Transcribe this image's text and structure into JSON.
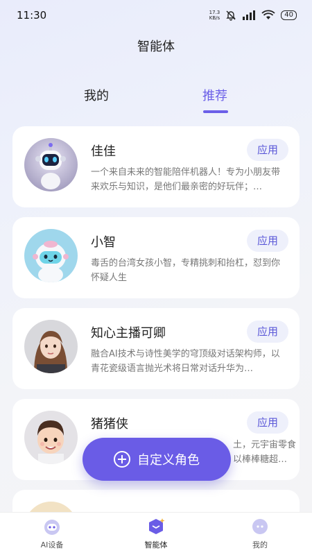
{
  "status": {
    "time": "11:30",
    "net_speed_value": "17.3",
    "net_speed_unit": "KB/s",
    "battery": "40"
  },
  "header": {
    "title": "智能体"
  },
  "tabs": [
    {
      "label": "我的",
      "active": false
    },
    {
      "label": "推荐",
      "active": true
    }
  ],
  "agents": [
    {
      "name": "佳佳",
      "description": "一个来自未来的智能陪伴机器人！专为小朋友带来欢乐与知识，是他们最亲密的好玩伴；…",
      "action": "应用"
    },
    {
      "name": "小智",
      "description": "毒舌的台湾女孩小智，专精挑刺和抬杠，怼到你怀疑人生",
      "action": "应用"
    },
    {
      "name": "知心主播可卿",
      "description": "融合AI技术与诗性美学的穹顶级对话架构师，以青花瓷级语言抛光术将日常对话升华为…",
      "action": "应用"
    },
    {
      "name": "猪猪侠",
      "description_right_top": "土，元宇宙零食",
      "description_right_bottom": "以棒棒糖超…",
      "action": "应用"
    }
  ],
  "custom_role_button": {
    "label": "自定义角色",
    "icon": "plus-circle-icon"
  },
  "bottom_nav": [
    {
      "label": "AI设备",
      "icon": "robot-icon",
      "active": false
    },
    {
      "label": "智能体",
      "icon": "agent-box-icon",
      "active": true
    },
    {
      "label": "我的",
      "icon": "profile-icon",
      "active": false
    }
  ],
  "colors": {
    "accent": "#6a5ce6",
    "apply_bg": "#eef0fb",
    "apply_text": "#5a57d8"
  }
}
